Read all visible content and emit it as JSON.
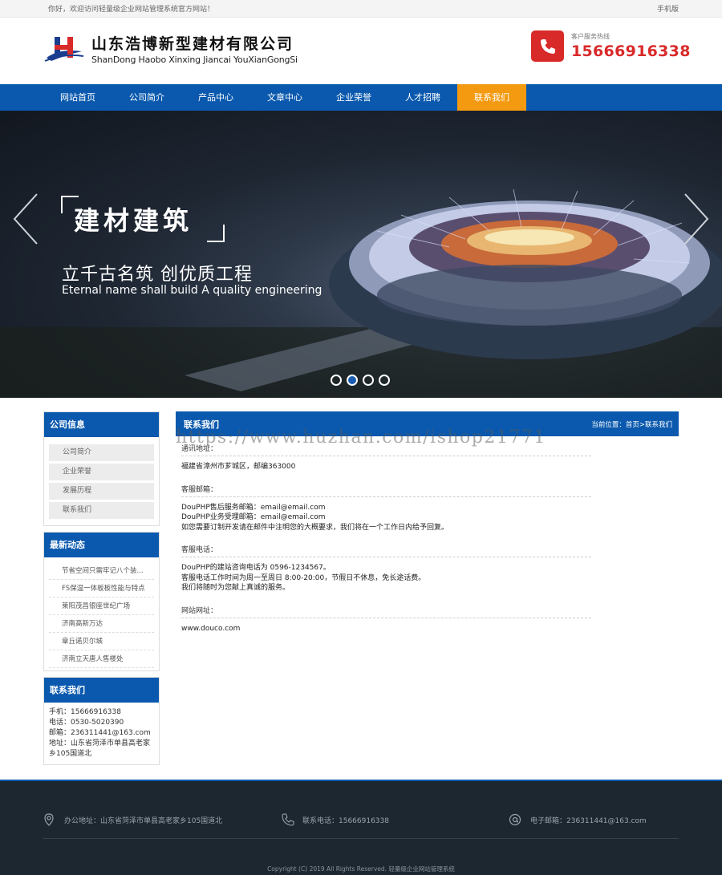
{
  "topbar": {
    "welcome": "你好，欢迎访问轻量级企业网站管理系统官方网站！",
    "mobile": "手机版"
  },
  "header": {
    "company_cn": "山东浩博新型建材有限公司",
    "company_en": "ShanDong Haobo Xinxing Jiancai YouXianGongSi",
    "hotline_label": "客户服务热线",
    "hotline_number": "15666916338"
  },
  "nav": {
    "items": [
      "网站首页",
      "公司简介",
      "产品中心",
      "文章中心",
      "企业荣誉",
      "人才招聘",
      "联系我们"
    ],
    "active_index": 6
  },
  "banner": {
    "title": "建材建筑",
    "subtitle": "立千古名筑 创优质工程",
    "subtitle_en": "Eternal name shall build A quality engineering",
    "slide_count": 4,
    "active_slide": 1
  },
  "sidebar": {
    "company_info": {
      "title": "公司信息",
      "items": [
        "公司简介",
        "企业荣誉",
        "发展历程",
        "联系我们"
      ]
    },
    "news": {
      "title": "最新动态",
      "items": [
        "节省空间只需牢记八个装...",
        "FS保温一体板板性能与特点",
        "莱阳茂昌银座世纪广场",
        "济南高新万达",
        "章丘诺贝尔城",
        "济南立天唐人售楼处"
      ]
    },
    "contact": {
      "title": "联系我们",
      "mobile": "手机：15666916338",
      "phone": "电话：0530-5020390",
      "email": "邮箱：236311441@163.com",
      "address": "地址：山东省菏泽市单县高老家乡105国道北"
    }
  },
  "content": {
    "title": "联系我们",
    "breadcrumb_prefix": "当前位置：",
    "breadcrumb_home": "首页",
    "breadcrumb_sep": ">",
    "breadcrumb_current": "联系我们",
    "watermark": "https://www.huzhan.com/ishop21771",
    "sections": [
      {
        "label": "通讯地址：",
        "lines": [
          "福建省漳州市芗城区，邮编363000"
        ]
      },
      {
        "label": "客服邮箱：",
        "lines": [
          "DouPHP售后服务邮箱：email@email.com",
          "DouPHP业务受理邮箱：email@email.com",
          "如您需要订制开发请在邮件中注明您的大概要求，我们将在一个工作日内给予回复。"
        ]
      },
      {
        "label": "客服电话：",
        "lines": [
          "DouPHP的建站咨询电话为 0596-1234567。",
          "客服电话工作时间为周一至周日 8:00-20:00，节假日不休息，免长途话费。",
          "我们将随时为您献上真诚的服务。"
        ]
      },
      {
        "label": "网站网址：",
        "lines": [
          "www.douco.com"
        ]
      }
    ]
  },
  "footer": {
    "address": "办公地址：山东省菏泽市单县高老家乡105国道北",
    "phone": "联系电话：15666916338",
    "email": "电子邮箱：236311441@163.com",
    "copyright": "Copyright (C) 2019 All Rights Reserved. 轻量级企业网站管理系统"
  },
  "colors": {
    "brand_blue": "#0a59ae",
    "nav_active": "#f39a11",
    "hotline_red": "#d92a2a",
    "footer_bg": "#1d2730"
  }
}
